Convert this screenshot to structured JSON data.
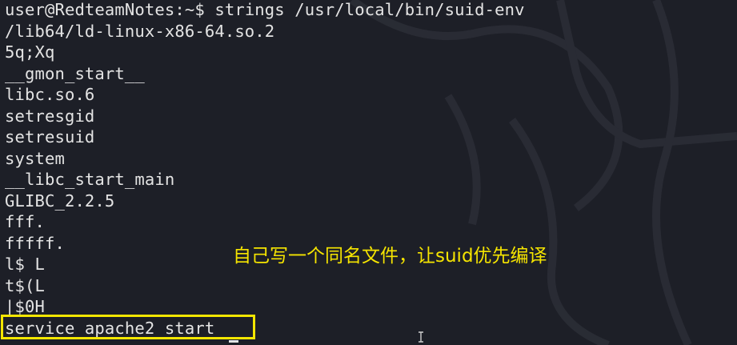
{
  "terminal": {
    "prompt": "user@RedteamNotes:~$ ",
    "command": "strings /usr/local/bin/suid-env",
    "output_lines": [
      "/lib64/ld-linux-x86-64.so.2",
      "5q;Xq",
      "__gmon_start__",
      "libc.so.6",
      "setresgid",
      "setresuid",
      "system",
      "__libc_start_main",
      "GLIBC_2.2.5",
      "fff.",
      "fffff.",
      "l$ L",
      "t$(L",
      "|$0H",
      "service apache2 start"
    ],
    "background_color": "#1d1f27",
    "text_color": "#e4e4e4"
  },
  "overlay": {
    "annotation_text": "自己写一个同名文件，让suid优先编译",
    "annotation_color": "#f5e400",
    "highlight_color": "#f3e600"
  },
  "icons": {
    "mouse_cursor": "i-beam-cursor-icon"
  }
}
